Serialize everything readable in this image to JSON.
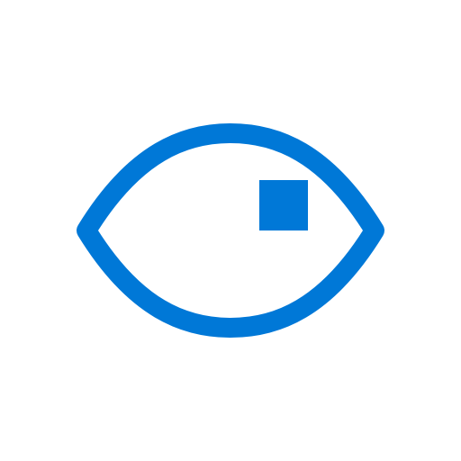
{
  "icon": {
    "name": "eye-icon",
    "color": "#0078d7",
    "background": "#ffffff"
  }
}
